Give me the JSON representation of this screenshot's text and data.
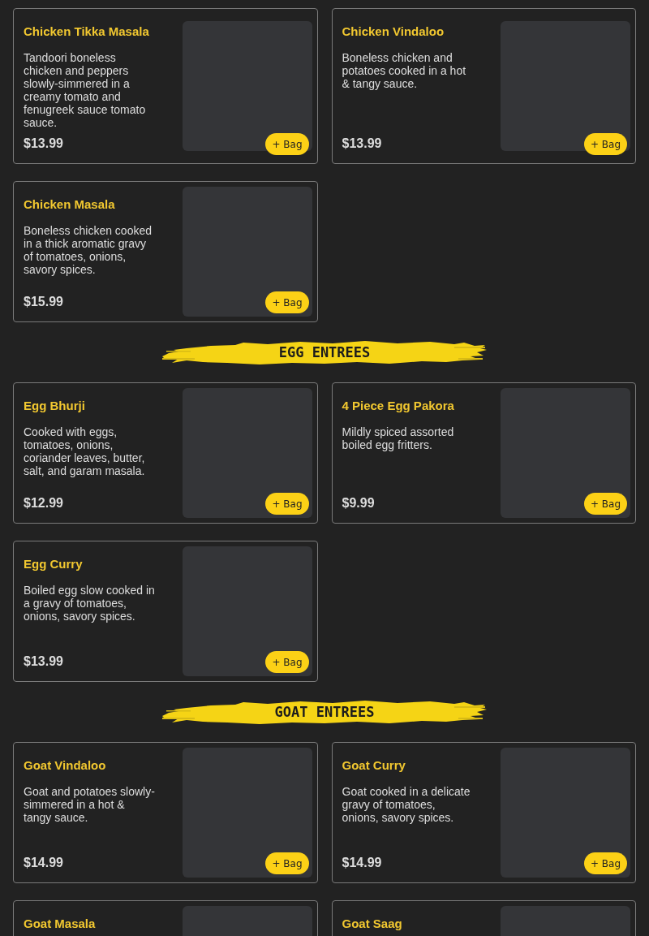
{
  "sections": [
    {
      "items": [
        {
          "name": "Chicken Tikka Masala",
          "description": "Tandoori boneless chicken and peppers slowly-simmered in a creamy tomato and fenugreek sauce tomato sauce.",
          "price": "$13.99",
          "button": "+ Bag"
        },
        {
          "name": "Chicken Vindaloo",
          "description": "Boneless chicken and potatoes cooked in a hot & tangy sauce.",
          "price": "$13.99",
          "button": "+ Bag"
        },
        {
          "name": "Chicken Masala",
          "description": "Boneless chicken cooked in a thick aromatic gravy of tomatoes, onions, savory spices.",
          "price": "$15.99",
          "button": "+ Bag"
        }
      ]
    },
    {
      "heading": "EGG ENTREES",
      "items": [
        {
          "name": "Egg Bhurji",
          "description": "Cooked with eggs, tomatoes, onions, coriander leaves, butter, salt, and garam masala.",
          "price": "$12.99",
          "button": "+ Bag"
        },
        {
          "name": "4 Piece Egg Pakora",
          "description": "Mildly spiced assorted boiled egg fritters.",
          "price": "$9.99",
          "button": "+ Bag"
        },
        {
          "name": "Egg Curry",
          "description": "Boiled egg slow cooked in a gravy of tomatoes, onions, savory spices.",
          "price": "$13.99",
          "button": "+ Bag"
        }
      ]
    },
    {
      "heading": "GOAT ENTREES",
      "items": [
        {
          "name": "Goat Vindaloo",
          "description": "Goat and potatoes slowly-simmered in a hot & tangy sauce.",
          "price": "$14.99",
          "button": "+ Bag"
        },
        {
          "name": "Goat Curry",
          "description": "Goat cooked in a delicate gravy of tomatoes, onions, savory spices.",
          "price": "$14.99",
          "button": "+ Bag"
        },
        {
          "name": "Goat Masala"
        },
        {
          "name": "Goat Saag"
        }
      ]
    }
  ]
}
